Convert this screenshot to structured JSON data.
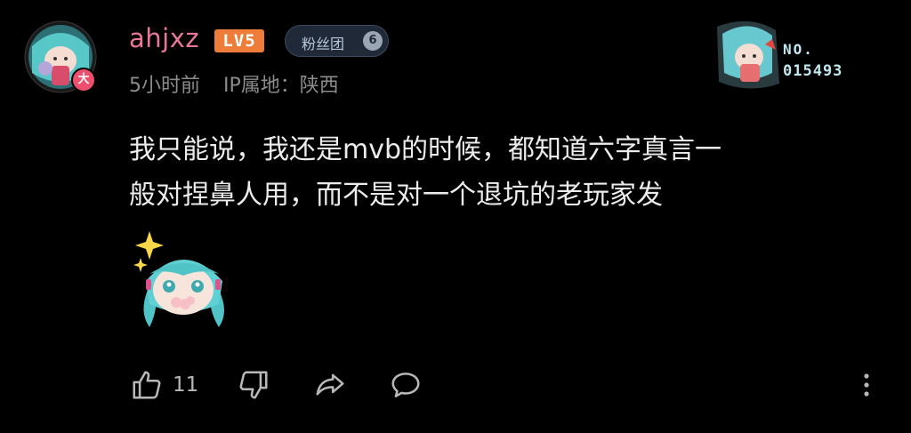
{
  "comment": {
    "username": "ahjxz",
    "level_label": "LV5",
    "fan_badge": {
      "label": "粉丝团",
      "level": "6"
    },
    "avatar_badge": "大",
    "time": "5小时前",
    "ip": "IP属地：陕西",
    "collection": {
      "no_label": "NO.",
      "number": "015493"
    },
    "text_line1": "我只能说，我还是mvb的时候，都知道六字真言一",
    "text_line2": "般对捏鼻人用，而不是对一个退坑的老玩家发"
  },
  "actions": {
    "like_count": "11",
    "icons": [
      "thumb-up-icon",
      "thumb-down-icon",
      "share-icon",
      "comment-icon",
      "more-icon"
    ]
  },
  "colors": {
    "background": "#000000",
    "username": "#e8779b",
    "level_badge": "#ee7d3a",
    "meta_text": "#8c8c8c",
    "body_text": "#ececec"
  }
}
